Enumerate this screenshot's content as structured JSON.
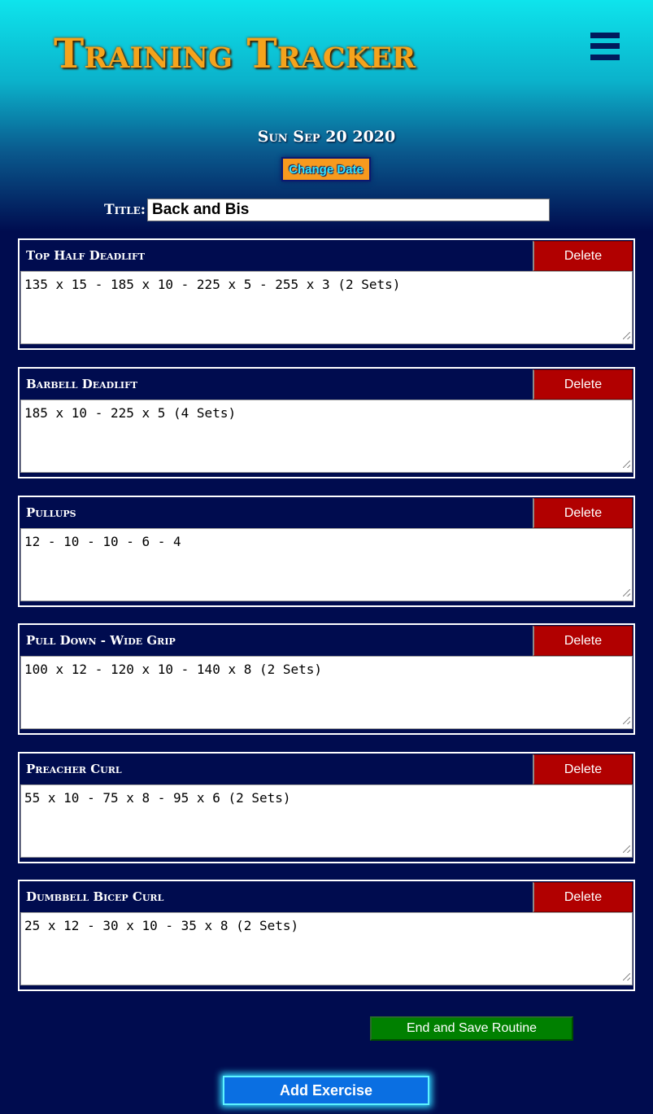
{
  "app": {
    "title": "Training Tracker",
    "menu_icon": "hamburger-menu-icon"
  },
  "session": {
    "date": "Sun Sep 20 2020",
    "change_date_label": "Change Date",
    "title_label": "Title:",
    "title_value": "Back and Bis"
  },
  "exercises": [
    {
      "name": "Top Half Deadlift",
      "notes": "135 x 15 - 185 x 10 - 225 x 5 - 255 x 3 (2 Sets)",
      "delete_label": "Delete"
    },
    {
      "name": "Barbell Deadlift",
      "notes": "185 x 10 - 225 x 5 (4 Sets)",
      "delete_label": "Delete"
    },
    {
      "name": "Pullups",
      "notes": "12 - 10 - 10 - 6 - 4",
      "delete_label": "Delete"
    },
    {
      "name": "Pull Down - Wide Grip",
      "notes": "100 x 12 - 120 x 10 - 140 x 8 (2 Sets)",
      "delete_label": "Delete"
    },
    {
      "name": "Preacher Curl",
      "notes": "55 x 10 - 75 x 8 - 95 x 6 (2 Sets)",
      "delete_label": "Delete"
    },
    {
      "name": "Dumbbell Bicep Curl",
      "notes": "25 x 12 - 30 x 10 - 35 x 8 (2 Sets)",
      "delete_label": "Delete"
    }
  ],
  "actions": {
    "end_save_label": "End and Save Routine",
    "add_exercise_label": "Add Exercise"
  },
  "colors": {
    "background": "#000c4f",
    "header_gradient_top": "#0ee4ec",
    "title_orange": "#f5a31c",
    "delete_red": "#b10000",
    "save_green": "#008000",
    "add_blue": "#0a6fe2",
    "glow_cyan": "#31d8ff"
  }
}
